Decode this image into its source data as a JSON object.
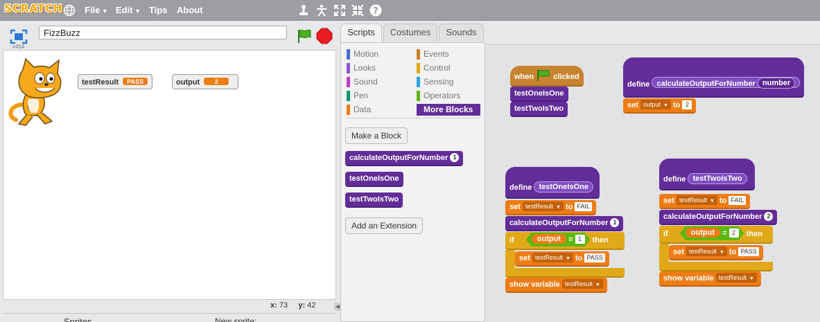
{
  "app": {
    "logo": "SCRATCH",
    "menus": [
      "File",
      "Edit",
      "Tips",
      "About"
    ],
    "version": "v454"
  },
  "project": {
    "title": "FizzBuzz"
  },
  "stage": {
    "monitors": [
      {
        "label": "testResult",
        "value": "PASS"
      },
      {
        "label": "output",
        "value": "2"
      }
    ],
    "mouse": {
      "x_label": "x:",
      "x": "73",
      "y_label": "y:",
      "y": "42"
    }
  },
  "sprites": {
    "label": "Sprites",
    "new_sprite": "New sprite:"
  },
  "tabs": [
    "Scripts",
    "Costumes",
    "Sounds"
  ],
  "categories": [
    {
      "label": "Motion",
      "color": "#4a6cd4"
    },
    {
      "label": "Looks",
      "color": "#8a55d7"
    },
    {
      "label": "Sound",
      "color": "#bb42c3"
    },
    {
      "label": "Pen",
      "color": "#0e9a6c"
    },
    {
      "label": "Data",
      "color": "#ee7d16"
    },
    {
      "label": "Events",
      "color": "#c88330"
    },
    {
      "label": "Control",
      "color": "#e1a91a"
    },
    {
      "label": "Sensing",
      "color": "#2ca5e2"
    },
    {
      "label": "Operators",
      "color": "#5cb712"
    },
    {
      "label": "More Blocks",
      "color": "#632d99"
    }
  ],
  "palette": {
    "make_block": "Make a Block",
    "add_extension": "Add an Extension",
    "blocks": [
      {
        "label": "calculateOutputForNumber",
        "arg": "1"
      },
      {
        "label": "testOneIsOne"
      },
      {
        "label": "testTwoIsTwo"
      }
    ]
  },
  "scripts": {
    "when_flag": {
      "when": "when",
      "clicked": "clicked",
      "calls": [
        "testOneIsOne",
        "testTwoIsTwo"
      ]
    },
    "define_calc": {
      "define": "define",
      "name": "calculateOutputForNumber",
      "param": "number",
      "set": "set",
      "var": "output",
      "to": "to",
      "value": "2"
    },
    "define_one": {
      "define": "define",
      "name": "testOneIsOne",
      "set1": "set",
      "var1": "testResult",
      "to1": "to",
      "val1": "FAIL",
      "call": "calculateOutputForNumber",
      "call_arg": "1",
      "if": "if",
      "cond_var": "output",
      "eq": "=",
      "cond_val": "1",
      "then": "then",
      "set2": "set",
      "var2": "testResult",
      "to2": "to",
      "val2": "PASS",
      "show": "show variable",
      "show_var": "testResult"
    },
    "define_two": {
      "define": "define",
      "name": "testTwoIsTwo",
      "set1": "set",
      "var1": "testResult",
      "to1": "to",
      "val1": "FAIL",
      "call": "calculateOutputForNumber",
      "call_arg": "2",
      "if": "if",
      "cond_var": "output",
      "eq": "=",
      "cond_val": "2",
      "then": "then",
      "set2": "set",
      "var2": "testResult",
      "to2": "to",
      "val2": "PASS",
      "show": "show variable",
      "show_var": "testResult"
    }
  }
}
